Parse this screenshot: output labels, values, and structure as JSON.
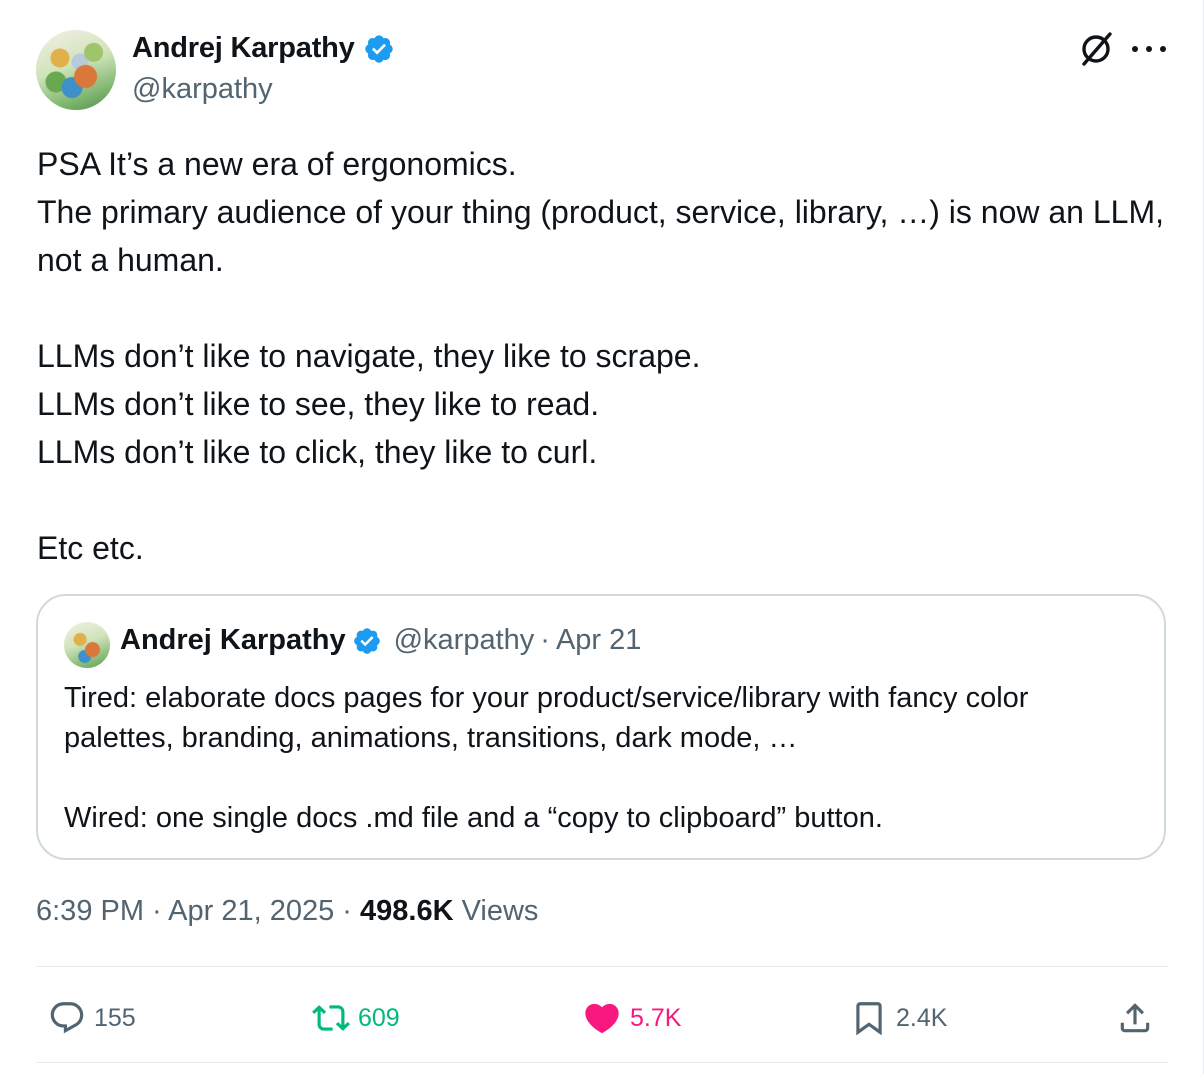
{
  "author": {
    "name": "Andrej Karpathy",
    "handle": "@karpathy",
    "verified": true
  },
  "header_icons": [
    "grok-icon",
    "more-icon"
  ],
  "tweet": {
    "lines": [
      "PSA It’s a new era of ergonomics.",
      "The primary audience of your thing (product, service, library, …) is now an LLM, not a human.",
      "LLMs don’t like to navigate, they like to scrape.",
      "LLMs don’t like to see, they like to read.",
      "LLMs don’t like to click, they like to curl.",
      "Etc etc."
    ]
  },
  "quote": {
    "name": "Andrej Karpathy",
    "handle": "@karpathy",
    "separator": "·",
    "date": "Apr 21",
    "text1": "Tired: elaborate docs pages for your product/service/library with fancy color palettes, branding, animations, transitions, dark mode, …",
    "text2": "Wired: one single docs .md file and a “copy to clipboard” button."
  },
  "meta": {
    "time": "6:39 PM",
    "sep1": " · ",
    "date": "Apr 21, 2025",
    "sep2": " · ",
    "views_count": "498.6K",
    "views_label": " Views"
  },
  "actions": {
    "replies": "155",
    "reposts": "609",
    "likes": "5.7K",
    "bookmarks": "2.4K"
  },
  "colors": {
    "text": "#0f1419",
    "secondary": "#536471",
    "verified": "#1d9bf0",
    "repost": "#00ba7c",
    "like": "#f91880",
    "border": "#cfd9de"
  }
}
